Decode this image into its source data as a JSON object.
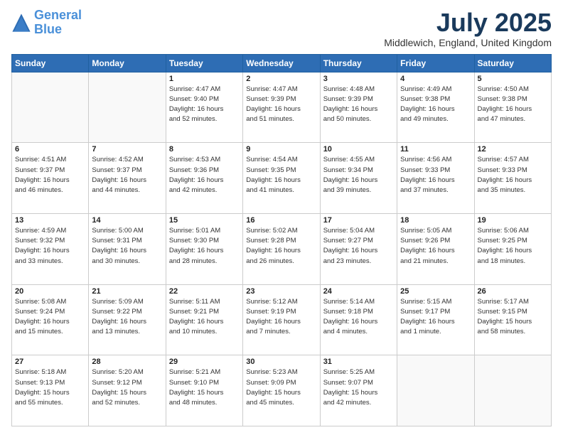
{
  "header": {
    "logo_general": "General",
    "logo_blue": "Blue",
    "title": "July 2025",
    "location": "Middlewich, England, United Kingdom"
  },
  "days_of_week": [
    "Sunday",
    "Monday",
    "Tuesday",
    "Wednesday",
    "Thursday",
    "Friday",
    "Saturday"
  ],
  "weeks": [
    [
      {
        "day": "",
        "info": ""
      },
      {
        "day": "",
        "info": ""
      },
      {
        "day": "1",
        "info": "Sunrise: 4:47 AM\nSunset: 9:40 PM\nDaylight: 16 hours\nand 52 minutes."
      },
      {
        "day": "2",
        "info": "Sunrise: 4:47 AM\nSunset: 9:39 PM\nDaylight: 16 hours\nand 51 minutes."
      },
      {
        "day": "3",
        "info": "Sunrise: 4:48 AM\nSunset: 9:39 PM\nDaylight: 16 hours\nand 50 minutes."
      },
      {
        "day": "4",
        "info": "Sunrise: 4:49 AM\nSunset: 9:38 PM\nDaylight: 16 hours\nand 49 minutes."
      },
      {
        "day": "5",
        "info": "Sunrise: 4:50 AM\nSunset: 9:38 PM\nDaylight: 16 hours\nand 47 minutes."
      }
    ],
    [
      {
        "day": "6",
        "info": "Sunrise: 4:51 AM\nSunset: 9:37 PM\nDaylight: 16 hours\nand 46 minutes."
      },
      {
        "day": "7",
        "info": "Sunrise: 4:52 AM\nSunset: 9:37 PM\nDaylight: 16 hours\nand 44 minutes."
      },
      {
        "day": "8",
        "info": "Sunrise: 4:53 AM\nSunset: 9:36 PM\nDaylight: 16 hours\nand 42 minutes."
      },
      {
        "day": "9",
        "info": "Sunrise: 4:54 AM\nSunset: 9:35 PM\nDaylight: 16 hours\nand 41 minutes."
      },
      {
        "day": "10",
        "info": "Sunrise: 4:55 AM\nSunset: 9:34 PM\nDaylight: 16 hours\nand 39 minutes."
      },
      {
        "day": "11",
        "info": "Sunrise: 4:56 AM\nSunset: 9:33 PM\nDaylight: 16 hours\nand 37 minutes."
      },
      {
        "day": "12",
        "info": "Sunrise: 4:57 AM\nSunset: 9:33 PM\nDaylight: 16 hours\nand 35 minutes."
      }
    ],
    [
      {
        "day": "13",
        "info": "Sunrise: 4:59 AM\nSunset: 9:32 PM\nDaylight: 16 hours\nand 33 minutes."
      },
      {
        "day": "14",
        "info": "Sunrise: 5:00 AM\nSunset: 9:31 PM\nDaylight: 16 hours\nand 30 minutes."
      },
      {
        "day": "15",
        "info": "Sunrise: 5:01 AM\nSunset: 9:30 PM\nDaylight: 16 hours\nand 28 minutes."
      },
      {
        "day": "16",
        "info": "Sunrise: 5:02 AM\nSunset: 9:28 PM\nDaylight: 16 hours\nand 26 minutes."
      },
      {
        "day": "17",
        "info": "Sunrise: 5:04 AM\nSunset: 9:27 PM\nDaylight: 16 hours\nand 23 minutes."
      },
      {
        "day": "18",
        "info": "Sunrise: 5:05 AM\nSunset: 9:26 PM\nDaylight: 16 hours\nand 21 minutes."
      },
      {
        "day": "19",
        "info": "Sunrise: 5:06 AM\nSunset: 9:25 PM\nDaylight: 16 hours\nand 18 minutes."
      }
    ],
    [
      {
        "day": "20",
        "info": "Sunrise: 5:08 AM\nSunset: 9:24 PM\nDaylight: 16 hours\nand 15 minutes."
      },
      {
        "day": "21",
        "info": "Sunrise: 5:09 AM\nSunset: 9:22 PM\nDaylight: 16 hours\nand 13 minutes."
      },
      {
        "day": "22",
        "info": "Sunrise: 5:11 AM\nSunset: 9:21 PM\nDaylight: 16 hours\nand 10 minutes."
      },
      {
        "day": "23",
        "info": "Sunrise: 5:12 AM\nSunset: 9:19 PM\nDaylight: 16 hours\nand 7 minutes."
      },
      {
        "day": "24",
        "info": "Sunrise: 5:14 AM\nSunset: 9:18 PM\nDaylight: 16 hours\nand 4 minutes."
      },
      {
        "day": "25",
        "info": "Sunrise: 5:15 AM\nSunset: 9:17 PM\nDaylight: 16 hours\nand 1 minute."
      },
      {
        "day": "26",
        "info": "Sunrise: 5:17 AM\nSunset: 9:15 PM\nDaylight: 15 hours\nand 58 minutes."
      }
    ],
    [
      {
        "day": "27",
        "info": "Sunrise: 5:18 AM\nSunset: 9:13 PM\nDaylight: 15 hours\nand 55 minutes."
      },
      {
        "day": "28",
        "info": "Sunrise: 5:20 AM\nSunset: 9:12 PM\nDaylight: 15 hours\nand 52 minutes."
      },
      {
        "day": "29",
        "info": "Sunrise: 5:21 AM\nSunset: 9:10 PM\nDaylight: 15 hours\nand 48 minutes."
      },
      {
        "day": "30",
        "info": "Sunrise: 5:23 AM\nSunset: 9:09 PM\nDaylight: 15 hours\nand 45 minutes."
      },
      {
        "day": "31",
        "info": "Sunrise: 5:25 AM\nSunset: 9:07 PM\nDaylight: 15 hours\nand 42 minutes."
      },
      {
        "day": "",
        "info": ""
      },
      {
        "day": "",
        "info": ""
      }
    ]
  ]
}
